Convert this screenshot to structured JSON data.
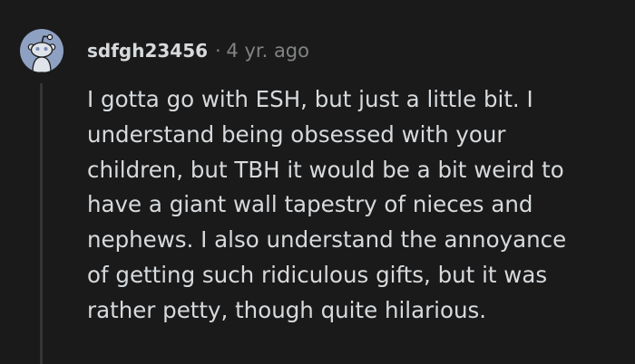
{
  "comment": {
    "author": "sdfgh23456",
    "separator": "·",
    "timestamp": "4 yr. ago",
    "avatar_icon": "snoo-avatar-icon",
    "colors": {
      "background": "#1a1a1b",
      "text": "#d7dadc",
      "muted": "#818384",
      "avatar": "#8fa1c2",
      "thread_line": "#343536"
    },
    "body_lines": [
      "I gotta go with ESH, but just a little bit. I",
      "understand being obsessed with your",
      "children, but TBH it would be a bit weird to",
      "have a giant wall tapestry of nieces and",
      "nephews. I also understand the annoyance",
      "of getting such ridiculous gifts, but it was",
      "rather petty, though quite hilarious."
    ]
  }
}
